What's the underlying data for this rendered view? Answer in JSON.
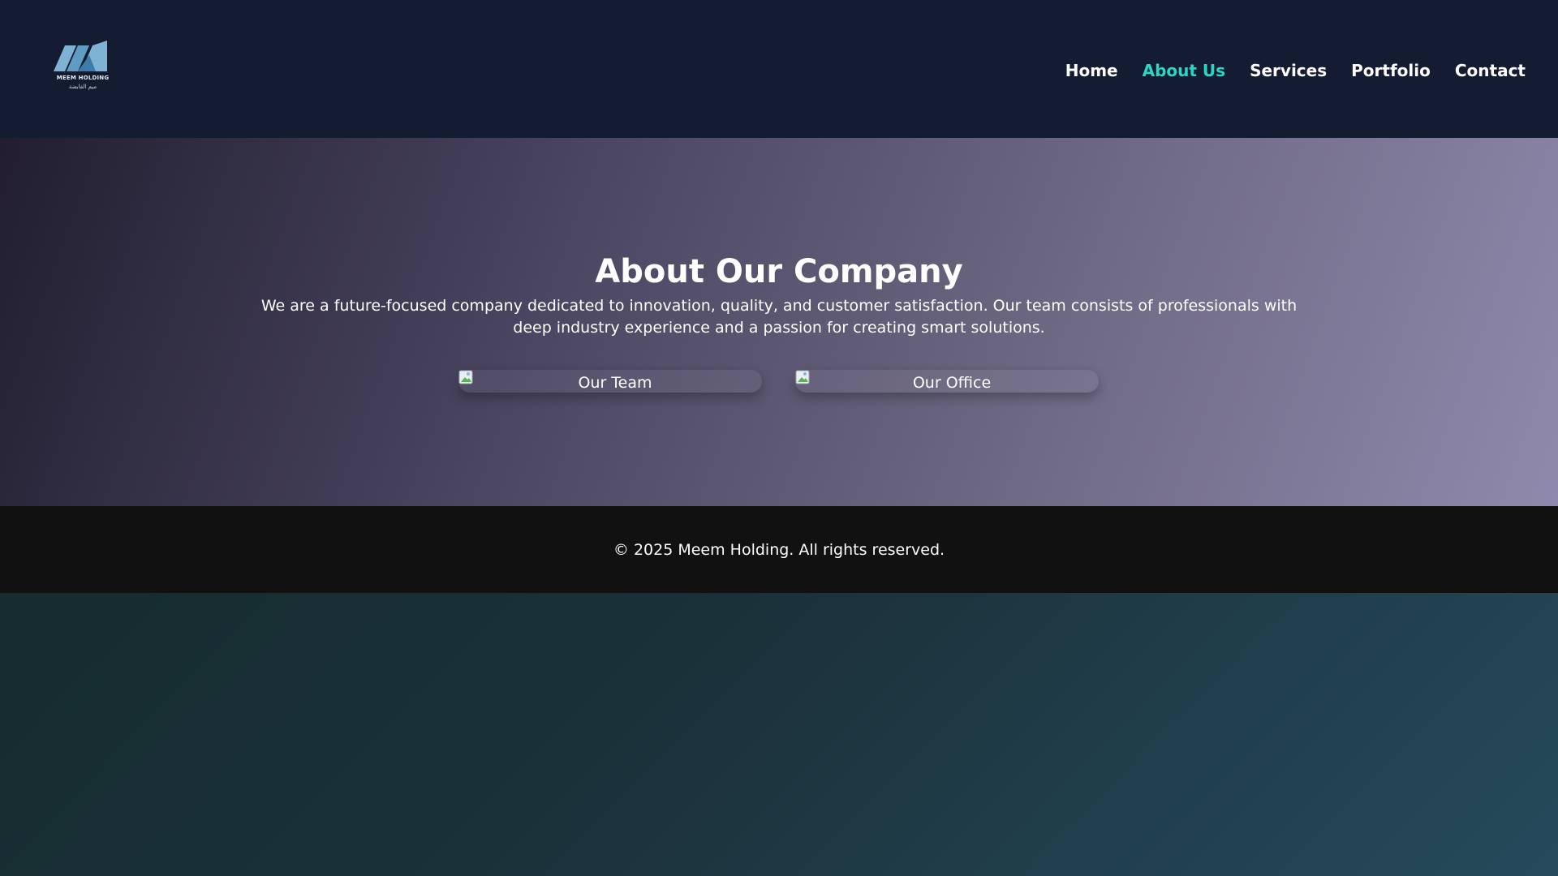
{
  "brand": {
    "name": "MEEM HOLDING",
    "sub_name": "ميم القابضة",
    "accent_color": "#26d9c7",
    "logo_color": "#7fb3d5"
  },
  "nav": {
    "items": [
      {
        "label": "Home",
        "active": false
      },
      {
        "label": "About Us",
        "active": true
      },
      {
        "label": "Services",
        "active": false
      },
      {
        "label": "Portfolio",
        "active": false
      },
      {
        "label": "Contact",
        "active": false
      }
    ]
  },
  "hero": {
    "title": "About Our Company",
    "text": "We are a future-focused company dedicated to innovation, quality, and customer satisfaction. Our team consists of professionals with deep industry experience and a passion for creating smart solutions.",
    "cards": [
      {
        "label": "Our Team",
        "icon": "broken-image-icon"
      },
      {
        "label": "Our Office",
        "icon": "broken-image-icon"
      }
    ]
  },
  "footer": {
    "text": "© 2025 Meem Holding. All rights reserved."
  }
}
